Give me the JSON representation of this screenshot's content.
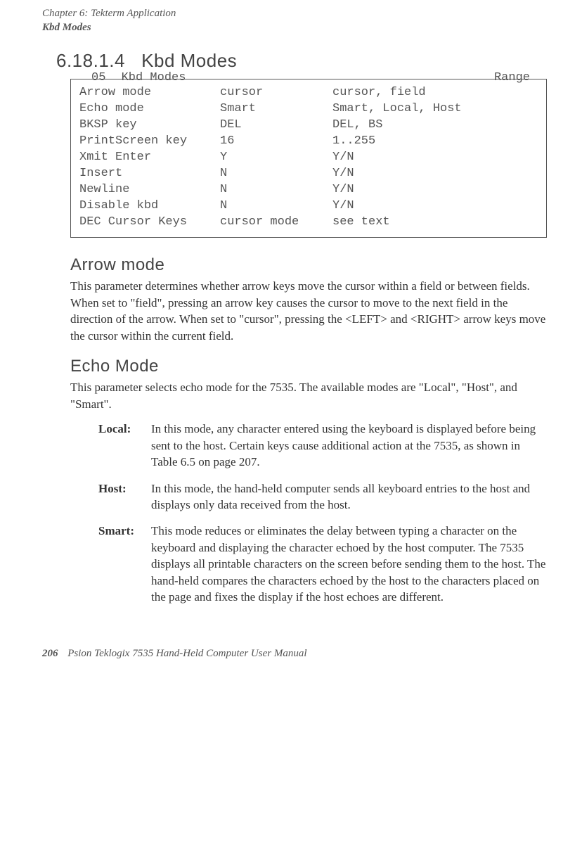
{
  "running_head": {
    "line1": "Chapter 6: Tekterm Application",
    "line2": "Kbd Modes"
  },
  "section": {
    "number": "6.18.1.4",
    "title": "Kbd Modes"
  },
  "config_box": {
    "header_left": "05",
    "header_title": "Kbd Modes",
    "header_right": "Range",
    "rows": [
      {
        "name": "Arrow mode",
        "val": "cursor",
        "range": "cursor, field"
      },
      {
        "name": "Echo mode",
        "val": "Smart",
        "range": "Smart, Local, Host"
      },
      {
        "name": "BKSP key",
        "val": "DEL",
        "range": "DEL, BS"
      },
      {
        "name": "PrintScreen key",
        "val": "16",
        "range": "1..255"
      },
      {
        "name": "Xmit Enter",
        "val": "Y",
        "range": "Y/N"
      },
      {
        "name": "Insert",
        "val": "N",
        "range": "Y/N"
      },
      {
        "name": "Newline",
        "val": "N",
        "range": "Y/N"
      },
      {
        "name": "Disable kbd",
        "val": "N",
        "range": "Y/N"
      },
      {
        "name": "DEC Cursor Keys",
        "val": "cursor mode",
        "range": "see text"
      }
    ]
  },
  "arrow_mode": {
    "heading": "Arrow mode",
    "para": "This parameter determines whether arrow keys move the cursor within a field or between fields. When set to \"field\", pressing an arrow key causes the cursor to move to the next field in the direction of the arrow. When set to \"cursor\", pressing the <LEFT> and <RIGHT> arrow keys move the cursor within the current field."
  },
  "echo_mode": {
    "heading": "Echo Mode",
    "para": "This parameter selects echo mode for the 7535. The available modes are \"Local\", \"Host\", and \"Smart\".",
    "defs": [
      {
        "term": "Local:",
        "desc": "In this mode, any character entered using the keyboard is displayed before being sent to the host. Certain keys cause additional action at the 7535, as shown in Table 6.5 on page 207."
      },
      {
        "term": "Host:",
        "desc": "In this mode, the hand-held computer sends all keyboard entries to the host and displays only data received from the host."
      },
      {
        "term": "Smart:",
        "desc": "This mode reduces or eliminates the delay between typing a character on the keyboard and displaying the character echoed by the host computer. The 7535 displays all printable characters on the screen before sending them to the host. The hand-held compares the characters echoed by the host to the characters placed on the page and fixes the display if the host echoes are different."
      }
    ]
  },
  "footer": {
    "pagenum": "206",
    "text": "Psion Teklogix 7535 Hand-Held Computer User Manual"
  }
}
